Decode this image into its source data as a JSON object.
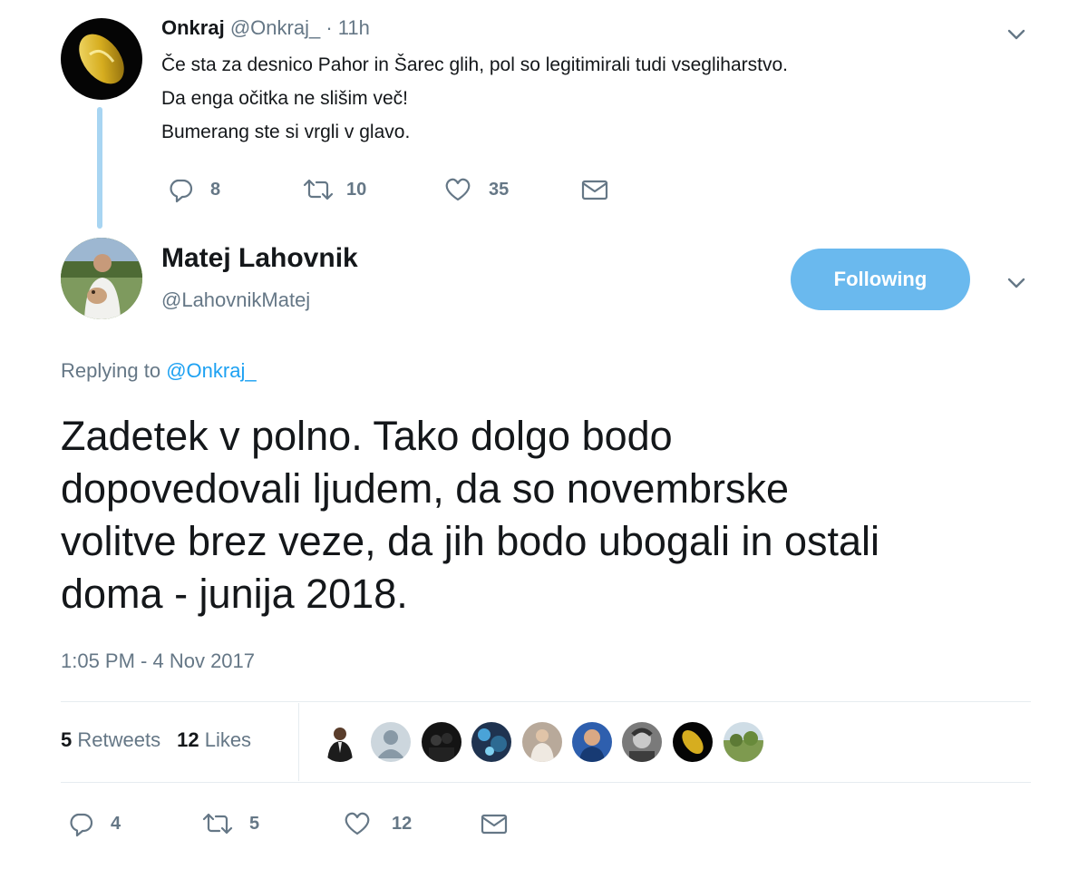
{
  "parent_tweet": {
    "name": "Onkraj",
    "handle": "@Onkraj_",
    "time": "11h",
    "lines": [
      "Če sta za desnico Pahor in Šarec glih, pol so legitimirali tudi vsegliharstvo.",
      "Da enga očitka ne slišim več!",
      "Bumerang ste si vrgli v glavo."
    ],
    "replies": "8",
    "retweets": "10",
    "likes": "35"
  },
  "main_tweet": {
    "name": "Matej Lahovnik",
    "handle": "@LahovnikMatej",
    "follow_label": "Following",
    "replying_prefix": "Replying to",
    "replying_to": "@Onkraj_",
    "text_lines": [
      "Zadetek v polno. Tako dolgo bodo",
      "dopovedovali ljudem, da so novembrske",
      "volitve brez veze, da jih bodo ubogali in ostali",
      "doma - junija 2018."
    ],
    "timestamp": "1:05 PM - 4 Nov 2017",
    "retweet_count": "5",
    "retweet_label": "Retweets",
    "like_count": "12",
    "like_label": "Likes",
    "actions": {
      "replies": "4",
      "retweets": "5",
      "likes": "12"
    }
  },
  "colors": {
    "accent": "#1da1f2",
    "follow_button": "#6ab9ee",
    "thread_line": "#a8d5f2",
    "muted_text": "#657786"
  },
  "icons": [
    "reply-icon",
    "retweet-icon",
    "like-icon",
    "message-icon",
    "chevron-down-icon"
  ]
}
